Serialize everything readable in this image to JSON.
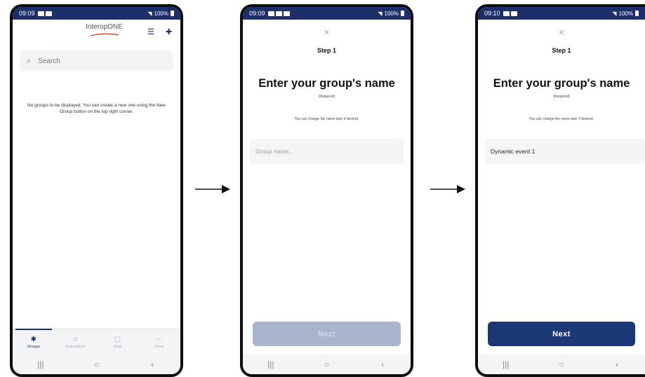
{
  "phone1": {
    "status": {
      "time": "09:09",
      "battery": "100%"
    },
    "logo": "InteropONE",
    "search_placeholder": "Search",
    "empty_message": "No groups to be displayed. You can create a new one using the New Group button on the top right corner.",
    "tabs": [
      {
        "label": "Groups",
        "icon": "groups-icon",
        "active": true
      },
      {
        "label": "Subscribers",
        "icon": "subscribers-icon",
        "active": false
      },
      {
        "label": "Chat",
        "icon": "chat-icon",
        "active": false
      },
      {
        "label": "More",
        "icon": "more-icon",
        "active": false
      }
    ]
  },
  "phone2": {
    "status": {
      "time": "09:09",
      "battery": "100%"
    },
    "step": "Step 1",
    "heading": "Enter your group's name",
    "required": "(Required)",
    "hint": "You can change the name later if desired.",
    "name_placeholder": "Group name...",
    "next_label": "Next"
  },
  "phone3": {
    "status": {
      "time": "09:10",
      "battery": "100%"
    },
    "step": "Step 1",
    "heading": "Enter your group's name",
    "required": "(Required)",
    "hint": "You can change the name later if desired.",
    "name_value": "Dynamic event 1",
    "next_label": "Next"
  },
  "colors": {
    "brand": "#1c2f6b",
    "button_enabled": "#1c3775",
    "button_disabled": "#aab4cd"
  }
}
